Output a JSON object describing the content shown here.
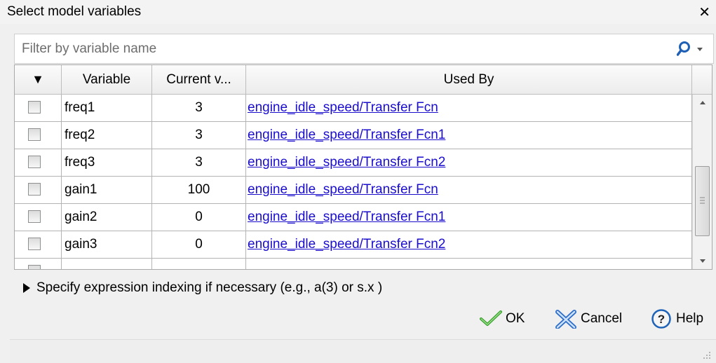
{
  "dialog": {
    "title": "Select model variables",
    "close_label": "✕"
  },
  "filter": {
    "placeholder": "Filter by variable name",
    "value": ""
  },
  "table": {
    "columns": {
      "menu": "▼",
      "variable": "Variable",
      "current_value": "Current v...",
      "used_by": "Used By"
    },
    "rows": [
      {
        "variable": "freq1",
        "value": "3",
        "used_by": "engine_idle_speed/Transfer Fcn",
        "checked": false
      },
      {
        "variable": "freq2",
        "value": "3",
        "used_by": "engine_idle_speed/Transfer Fcn1",
        "checked": false
      },
      {
        "variable": "freq3",
        "value": "3",
        "used_by": "engine_idle_speed/Transfer Fcn2",
        "checked": false
      },
      {
        "variable": "gain1",
        "value": "100",
        "used_by": "engine_idle_speed/Transfer Fcn",
        "checked": false
      },
      {
        "variable": "gain2",
        "value": "0",
        "used_by": "engine_idle_speed/Transfer Fcn1",
        "checked": false
      },
      {
        "variable": "gain3",
        "value": "0",
        "used_by": "engine_idle_speed/Transfer Fcn2",
        "checked": false
      }
    ]
  },
  "expander": {
    "label": "Specify expression indexing if necessary (e.g., a(3) or s.x )"
  },
  "buttons": {
    "ok": "OK",
    "cancel": "Cancel",
    "help": "Help"
  },
  "colors": {
    "link": "#1a0dcc",
    "ok_check": "#3aa12f",
    "cancel_x": "#2f6fc8",
    "help_ring": "#1f63b9"
  }
}
